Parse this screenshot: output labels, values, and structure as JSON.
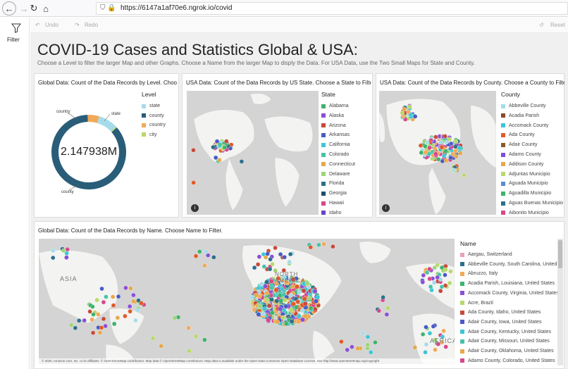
{
  "browser": {
    "url": "https://6147a1af70e6.ngrok.io/covid",
    "back_icon": "back-arrow-icon",
    "forward_icon": "forward-arrow-icon",
    "reload_icon": "reload-icon",
    "home_icon": "home-icon"
  },
  "rail": {
    "filter_label": "Filter"
  },
  "toolbar": {
    "undo": "Undo",
    "redo": "Redo",
    "reset": "Reset"
  },
  "header": {
    "title": "COVID-19 Cases and Statistics Global & USA:",
    "subtitle": "Choose a Level to filter the larger Map and other Graphs. Choose a Name from the larger Map to disply the Data. For USA Data, use the Two Small Maps for State and County."
  },
  "panels": {
    "global_level": {
      "title": "Global Data: Count of the Data Records by Level. Choo...",
      "legend_title": "Level",
      "legend": [
        {
          "label": "state",
          "color": "#a6dbea"
        },
        {
          "label": "county",
          "color": "#2a5d78"
        },
        {
          "label": "country",
          "color": "#f2a957"
        },
        {
          "label": "city",
          "color": "#b8d86a"
        }
      ],
      "center_value": "2.147938M",
      "callouts": {
        "country": "country",
        "state": "state",
        "county": "county"
      }
    },
    "usa_state": {
      "title": "USA Data: Count of the Data Records by US State. Choose a State to Filter:",
      "legend_title": "State",
      "legend": [
        {
          "label": "Alabama",
          "color": "#3eb36c"
        },
        {
          "label": "Alaska",
          "color": "#8a4fd6"
        },
        {
          "label": "Arizona",
          "color": "#c84a3a"
        },
        {
          "label": "Arkansas",
          "color": "#4a5ac4"
        },
        {
          "label": "California",
          "color": "#3ec5d6"
        },
        {
          "label": "Colorado",
          "color": "#47c2a8"
        },
        {
          "label": "Connecticut",
          "color": "#e6a84a"
        },
        {
          "label": "Delaware",
          "color": "#9dd47a"
        },
        {
          "label": "Florida",
          "color": "#2c6f8c"
        },
        {
          "label": "Georgia",
          "color": "#1f4f6b"
        },
        {
          "label": "Hawaii",
          "color": "#d6478a"
        },
        {
          "label": "Idaho",
          "color": "#6a42c4"
        }
      ]
    },
    "usa_county": {
      "title": "USA Data: Count of the Data Records by County. Choose a County to Filter:",
      "legend_title": "County",
      "legend": [
        {
          "label": "Abbeville County",
          "color": "#a6dbea"
        },
        {
          "label": "Acadia Parish",
          "color": "#8a4a2a"
        },
        {
          "label": "Accomack County",
          "color": "#3ec5d6"
        },
        {
          "label": "Ada County",
          "color": "#e05a2a"
        },
        {
          "label": "Adair County",
          "color": "#8a5a2a"
        },
        {
          "label": "Adams County",
          "color": "#7a4fd6"
        },
        {
          "label": "Addison County",
          "color": "#e6a84a"
        },
        {
          "label": "Adjuntas Municipio",
          "color": "#b8d86a"
        },
        {
          "label": "Aguada Municipio",
          "color": "#5a8ad6"
        },
        {
          "label": "Aguadilla Municipio",
          "color": "#3eb36c"
        },
        {
          "label": "Aguas Buenas Municipio",
          "color": "#2c6f8c"
        },
        {
          "label": "Aibonito Municipio",
          "color": "#d6478a"
        }
      ]
    },
    "global_name": {
      "title": "Global Data: Count of the Data Records by Name. Choose Name to Filter.",
      "legend_title": "Name",
      "legend": [
        {
          "label": "Aargau, Switzerland",
          "color": "#e8a0c0"
        },
        {
          "label": "Abbeville County, South Carolina, United",
          "color": "#2c6f8c"
        },
        {
          "label": "Abruzzo, Italy",
          "color": "#f2a957"
        },
        {
          "label": "Acadia Parish, Louisiana, United States",
          "color": "#3eb36c"
        },
        {
          "label": "Accomack County, Virginia, United States",
          "color": "#8a4fd6"
        },
        {
          "label": "Acre, Brazil",
          "color": "#b8d86a"
        },
        {
          "label": "Ada County, Idaho, United States",
          "color": "#c84a3a"
        },
        {
          "label": "Adair County, Iowa, United States",
          "color": "#4a5ac4"
        },
        {
          "label": "Adair County, Kentucky, United States",
          "color": "#3ec5d6"
        },
        {
          "label": "Adair County, Missouri, United States",
          "color": "#47c2a8"
        },
        {
          "label": "Adair County, Oklahoma, United States",
          "color": "#e6a84a"
        },
        {
          "label": "Adams County, Colorado, United States",
          "color": "#d6478a"
        }
      ],
      "map_labels": {
        "asia": "ASIA",
        "north_america": "NORTH AMERICA",
        "africa": "AFRICA"
      },
      "attribution": "© 2020, Amazon.com, Inc. or its affiliates. © OpenStreetMap contributors. Map data © OpenStreetMap contributors. Map data is available under the Open Data Commons Open Database License. See http://www.openstreetmap.org/copyright"
    }
  },
  "chart_data": {
    "type": "pie",
    "title": "Global Data: Count of the Data Records by Level. Choo...",
    "categories": [
      "county",
      "country",
      "state",
      "city"
    ],
    "values": [
      0.86,
      0.05,
      0.085,
      0.005
    ],
    "total_label": "2.147938M",
    "legend_placement": "right"
  }
}
